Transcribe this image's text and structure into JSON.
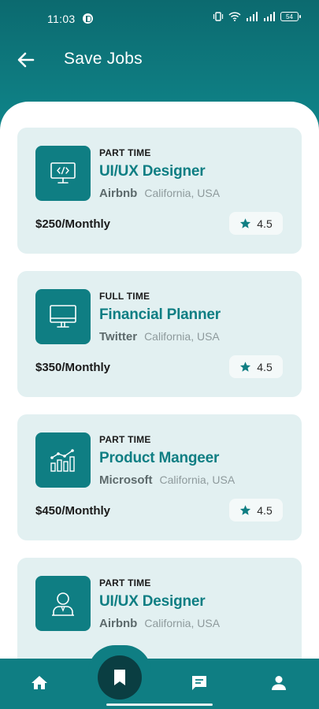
{
  "status_bar": {
    "time": "11:03",
    "battery": "54"
  },
  "header": {
    "title": "Save Jobs"
  },
  "jobs": [
    {
      "type": "PART TIME",
      "title": "UI/UX Designer",
      "company": "Airbnb",
      "location": "California, USA",
      "salary": "$250/Monthly",
      "rating": "4.5",
      "icon": "monitor-code-icon"
    },
    {
      "type": "FULL TIME",
      "title": "Financial Planner",
      "company": "Twitter",
      "location": "California, USA",
      "salary": "$350/Monthly",
      "rating": "4.5",
      "icon": "monitor-icon"
    },
    {
      "type": "PART TIME",
      "title": "Product Mangeer",
      "company": "Microsoft",
      "location": "California, USA",
      "salary": "$450/Monthly",
      "rating": "4.5",
      "icon": "chart-growth-icon"
    },
    {
      "type": "PART TIME",
      "title": "UI/UX Designer",
      "company": "Airbnb",
      "location": "California, USA",
      "salary": "",
      "rating": "",
      "icon": "user-person-icon"
    }
  ],
  "nav": [
    "home-icon",
    "bookmark-icon",
    "chat-icon",
    "profile-icon"
  ],
  "colors": {
    "primary": "#0f7e83",
    "card_bg": "#e2f0f1",
    "fab": "#0a3e42"
  }
}
